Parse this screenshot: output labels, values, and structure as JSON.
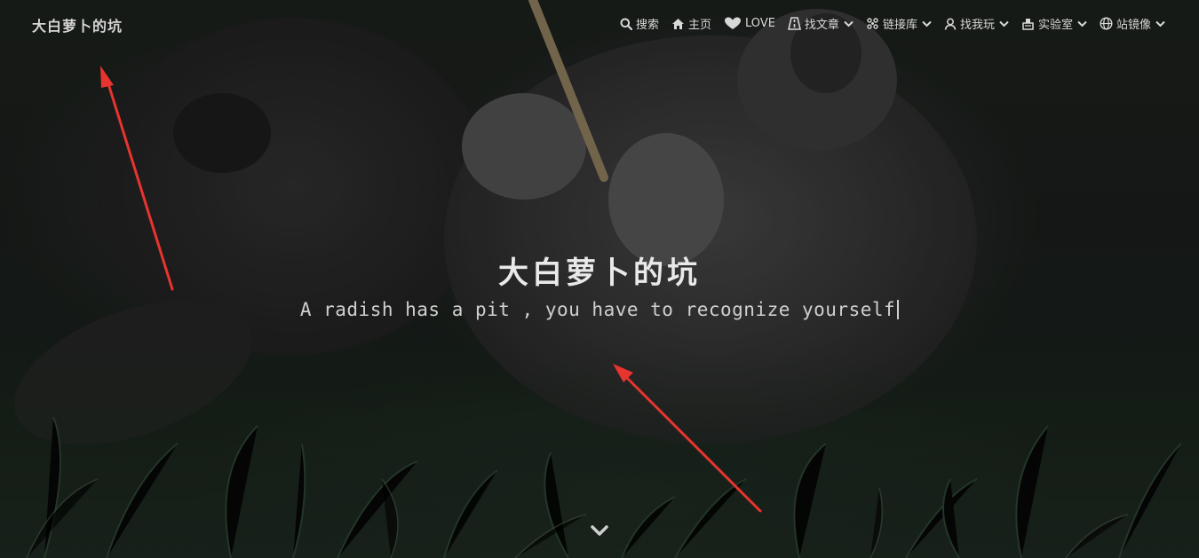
{
  "header": {
    "brand": "大白萝卜的坑"
  },
  "nav": {
    "items": [
      {
        "label": "搜索",
        "icon": "search-icon",
        "dropdown": false
      },
      {
        "label": "主页",
        "icon": "home-icon",
        "dropdown": false
      },
      {
        "label": "LOVE",
        "icon": "heart-icon",
        "dropdown": false
      },
      {
        "label": "找文章",
        "icon": "road-icon",
        "dropdown": true
      },
      {
        "label": "链接库",
        "icon": "cluster-icon",
        "dropdown": true
      },
      {
        "label": "找我玩",
        "icon": "user-icon",
        "dropdown": true
      },
      {
        "label": "实验室",
        "icon": "lab-icon",
        "dropdown": true
      },
      {
        "label": "站镜像",
        "icon": "globe-icon",
        "dropdown": true
      }
    ]
  },
  "hero": {
    "title": "大白萝卜的坑",
    "subtitle": "A radish has a pit , you have to recognize yourself",
    "scroll_icon": "chevron-down-icon"
  },
  "annotations": {
    "color": "#e8342f"
  },
  "colors": {
    "nav_text": "#d8d8d8",
    "title_text": "#e9e9e9"
  }
}
